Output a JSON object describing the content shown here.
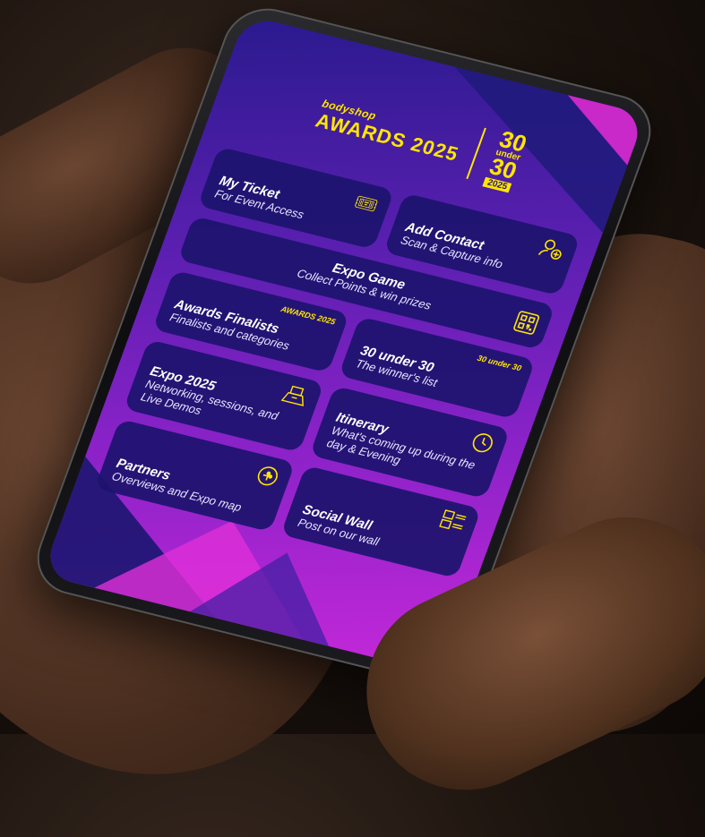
{
  "header": {
    "brand_small": "bodyshop",
    "brand_title": "AWARDS 2025",
    "logo_top": "30",
    "logo_mid": "under",
    "logo_bottom": "30",
    "logo_year": "2025"
  },
  "tiles": [
    {
      "title": "My Ticket",
      "subtitle": "For Event Access",
      "icon": "ticket-icon"
    },
    {
      "title": "Add Contact",
      "subtitle": "Scan & Capture info",
      "icon": "add-user-icon"
    },
    {
      "title": "Expo Game",
      "subtitle": "Collect Points & win prizes",
      "icon": "qr-code-icon"
    },
    {
      "title": "Awards Finalists",
      "subtitle": "Finalists and categories",
      "badge": "AWARDS 2025"
    },
    {
      "title": "30 under 30",
      "subtitle": "The winner's list",
      "badge": "30 under 30"
    },
    {
      "title": "Expo 2025",
      "subtitle": "Networking, sessions, and Live Demos",
      "icon": "expo-booth-icon"
    },
    {
      "title": "Itinerary",
      "subtitle": "What's coming up during the day & Evening",
      "icon": "clock-icon"
    },
    {
      "title": "Partners",
      "subtitle": "Overviews and Expo map",
      "icon": "puzzle-icon"
    },
    {
      "title": "Social Wall",
      "subtitle": "Post on our wall",
      "icon": "gallery-icon"
    }
  ],
  "colors": {
    "accent": "#ffe600",
    "tile_bg": "#1c146e",
    "gradient_start": "#2a1a8e",
    "gradient_end": "#c428d8"
  }
}
